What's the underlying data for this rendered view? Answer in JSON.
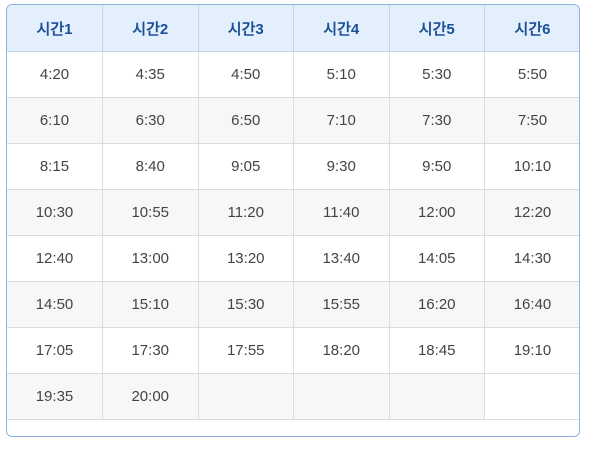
{
  "table": {
    "headers": [
      "시간1",
      "시간2",
      "시간3",
      "시간4",
      "시간5",
      "시간6"
    ],
    "rows": [
      [
        "4:20",
        "4:35",
        "4:50",
        "5:10",
        "5:30",
        "5:50"
      ],
      [
        "6:10",
        "6:30",
        "6:50",
        "7:10",
        "7:30",
        "7:50"
      ],
      [
        "8:15",
        "8:40",
        "9:05",
        "9:30",
        "9:50",
        "10:10"
      ],
      [
        "10:30",
        "10:55",
        "11:20",
        "11:40",
        "12:00",
        "12:20"
      ],
      [
        "12:40",
        "13:00",
        "13:20",
        "13:40",
        "14:05",
        "14:30"
      ],
      [
        "14:50",
        "15:10",
        "15:30",
        "15:55",
        "16:20",
        "16:40"
      ],
      [
        "17:05",
        "17:30",
        "17:55",
        "18:20",
        "18:45",
        "19:10"
      ],
      [
        "19:35",
        "20:00",
        "",
        "",
        "",
        ""
      ]
    ]
  }
}
